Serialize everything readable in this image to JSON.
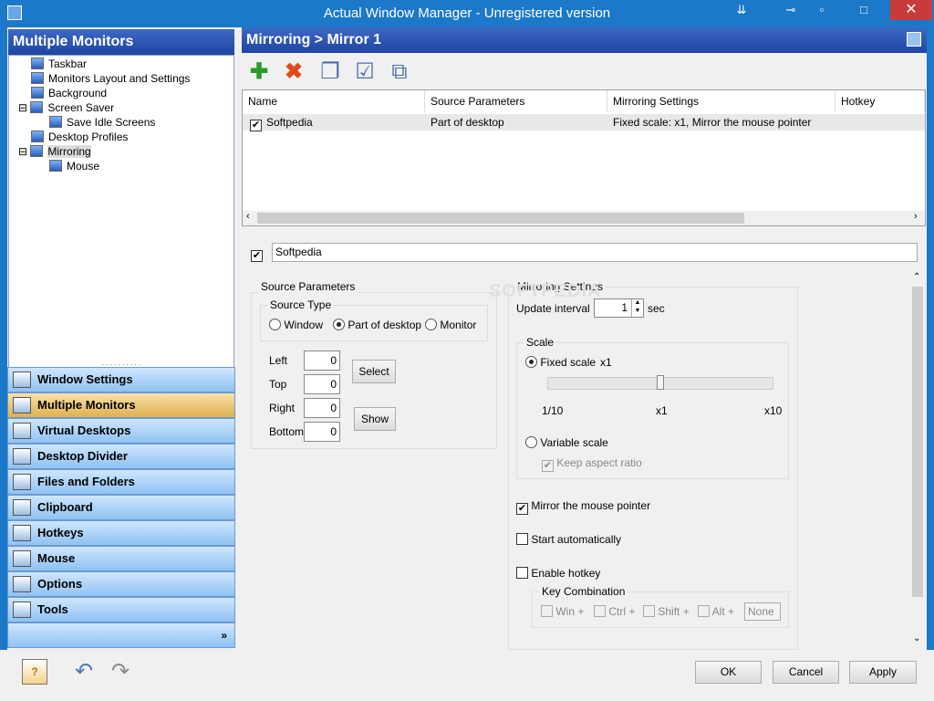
{
  "window": {
    "title": "Actual Window Manager - Unregistered version"
  },
  "sidebar": {
    "title": "Multiple Monitors",
    "tree": [
      "Taskbar",
      "Monitors Layout and Settings",
      "Background",
      "Screen Saver",
      "Save Idle Screens",
      "Desktop Profiles",
      "Mirroring",
      "Mouse"
    ],
    "nav": [
      "Window Settings",
      "Multiple Monitors",
      "Virtual Desktops",
      "Desktop Divider",
      "Files and Folders",
      "Clipboard",
      "Hotkeys",
      "Mouse",
      "Options",
      "Tools"
    ],
    "more": "»"
  },
  "main": {
    "breadcrumb": "Mirroring > Mirror 1",
    "list": {
      "columns": [
        "Name",
        "Source Parameters",
        "Mirroring Settings",
        "Hotkey"
      ],
      "rows": [
        {
          "name": "Softpedia",
          "source": "Part of desktop",
          "mirroring": "Fixed scale: x1, Mirror the mouse pointer",
          "hotkey": ""
        }
      ]
    },
    "name_value": "Softpedia",
    "source": {
      "title": "Source Parameters",
      "type_title": "Source Type",
      "types": [
        "Window",
        "Part of desktop",
        "Monitor"
      ],
      "left_label": "Left",
      "left": "0",
      "top_label": "Top",
      "top": "0",
      "right_label": "Right",
      "right": "0",
      "bottom_label": "Bottom",
      "bottom": "0",
      "select": "Select",
      "show": "Show"
    },
    "mirroring": {
      "title": "Mirroring Settings",
      "interval_label": "Update interval",
      "interval": "1",
      "sec": "sec",
      "scale_title": "Scale",
      "fixed": "Fixed scale",
      "fixed_value": "x1",
      "ticks": [
        "1/10",
        "x1",
        "x10"
      ],
      "variable": "Variable scale",
      "keep_aspect": "Keep aspect ratio",
      "mirror_pointer": "Mirror the mouse pointer",
      "start_auto": "Start automatically",
      "enable_hotkey": "Enable hotkey",
      "key_combo": "Key Combination",
      "keys": [
        "Win +",
        "Ctrl +",
        "Shift +",
        "Alt +"
      ],
      "key_value": "None"
    }
  },
  "footer": {
    "ok": "OK",
    "cancel": "Cancel",
    "apply": "Apply"
  },
  "watermark": "SOFTPEDIA"
}
